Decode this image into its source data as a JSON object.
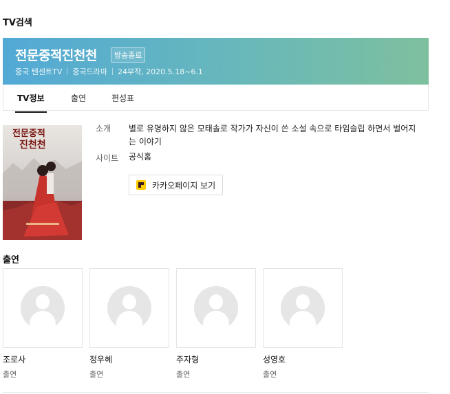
{
  "section_title": "TV검색",
  "program": {
    "title": "전문중적진천천",
    "status_badge": "방송종료",
    "meta": [
      "중국 텐센트TV",
      "중국드라마",
      "24부작, 2020.5.18~6.1"
    ],
    "banner_colors": [
      "#52a9d6",
      "#7ec09e"
    ]
  },
  "tabs": [
    {
      "label": "TV정보",
      "active": true
    },
    {
      "label": "출연",
      "active": false
    },
    {
      "label": "편성표",
      "active": false
    }
  ],
  "poster": {
    "title_text": "전문중적진천천",
    "icon": "drama-poster-image"
  },
  "info": {
    "synopsis_label": "소개",
    "synopsis": "별로 유명하지 않은 모태솔로 작가가 자신이 쓴 소설 속으로 타임슬립 하면서 벌어지는 이야기",
    "site_label": "사이트",
    "site_link": "공식홈",
    "kakao_button": "카카오페이지 보기",
    "kakao_color": "#ffcd00"
  },
  "cast": {
    "title": "출연",
    "members": [
      {
        "name": "조로사",
        "role": "출연"
      },
      {
        "name": "정우혜",
        "role": "출연"
      },
      {
        "name": "주자형",
        "role": "출연"
      },
      {
        "name": "성영호",
        "role": "출연"
      }
    ]
  }
}
